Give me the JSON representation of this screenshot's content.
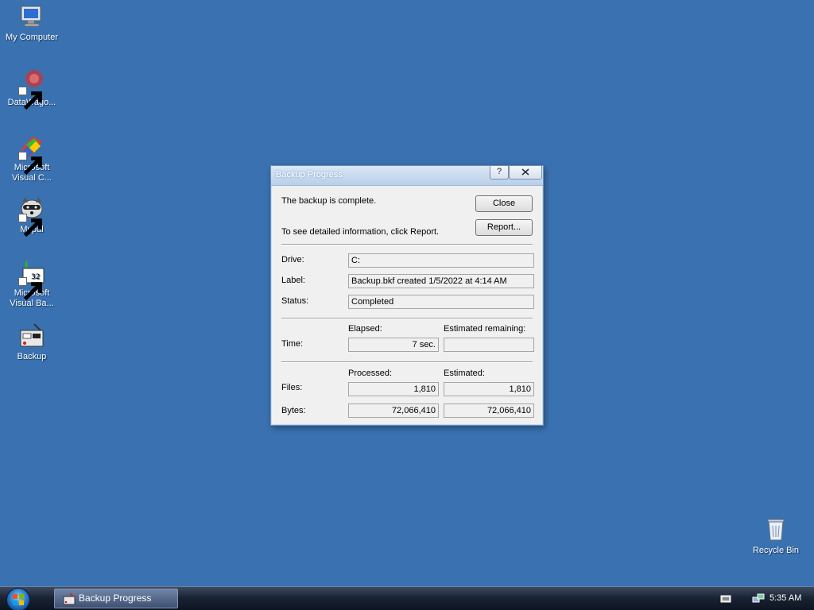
{
  "desktop": {
    "icons": [
      {
        "label": "My Computer"
      },
      {
        "label": "DataWago..."
      },
      {
        "label_line1": "Microsoft",
        "label_line2": "Visual C..."
      },
      {
        "label": "Mypal"
      },
      {
        "label_line1": "Microsoft",
        "label_line2": "Visual Ba..."
      },
      {
        "label": "Backup"
      },
      {
        "label": "Recycle Bin"
      }
    ]
  },
  "dialog": {
    "title": "Backup Progress",
    "help_btn": "?",
    "message": "The backup is complete.",
    "report_hint": "To see detailed information, click Report.",
    "close_button": "Close",
    "report_button": "Report...",
    "drive_label": "Drive:",
    "drive_value": "C:",
    "label_label": "Label:",
    "label_value": "Backup.bkf created 1/5/2022 at 4:14 AM",
    "status_label": "Status:",
    "status_value": "Completed",
    "elapsed_header": "Elapsed:",
    "remaining_header": "Estimated remaining:",
    "time_label": "Time:",
    "elapsed_value": "7 sec.",
    "remaining_value": "",
    "processed_header": "Processed:",
    "estimated_header": "Estimated:",
    "files_label": "Files:",
    "files_processed": "1,810",
    "files_estimated": "1,810",
    "bytes_label": "Bytes:",
    "bytes_processed": "72,066,410",
    "bytes_estimated": "72,066,410"
  },
  "taskbar": {
    "task_button": "Backup Progress",
    "clock": "5:35 AM"
  },
  "colors": {
    "desktop": "#3a72b1",
    "dialog_bg": "#f0f0f0",
    "taskbar": "#1a2333"
  }
}
